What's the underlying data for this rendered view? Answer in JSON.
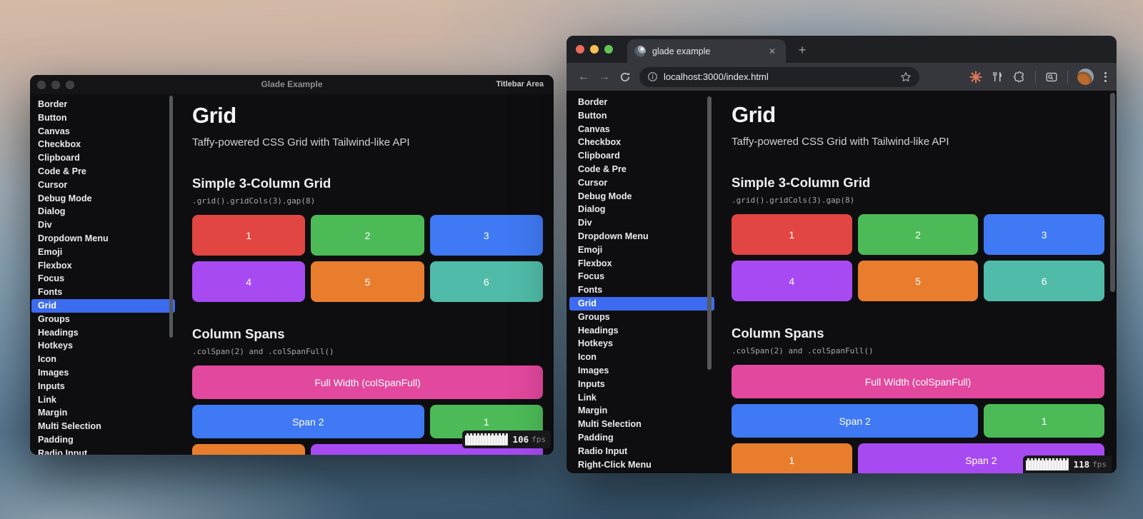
{
  "app_window": {
    "title": "Glade Example",
    "titlebar_right": "Titlebar Area",
    "fps": {
      "value": "106",
      "unit": "fps"
    },
    "traffic_light_inactive_color": "#3e3f43"
  },
  "browser_window": {
    "tab_title": "glade example",
    "url": "localhost:3000/index.html",
    "fps": {
      "value": "118",
      "unit": "fps"
    },
    "traffic_light_colors": [
      "#ed6a5e",
      "#f4bf50",
      "#61c454"
    ],
    "icons": {
      "back": "←",
      "forward": "→",
      "new_tab": "+",
      "close_tab": "✕",
      "menu": "⋮",
      "named": [
        "globe-favicon",
        "reload-icon",
        "site-info-icon",
        "bookmark-star-icon",
        "starburst-extension-icon",
        "utensils-extension-icon",
        "extensions-puzzle-icon",
        "side-panel-search-icon",
        "profile-avatar",
        "menu-dots-icon"
      ]
    }
  },
  "sidebar": {
    "selected_color": "#3c6bf0",
    "items": [
      {
        "label": "Border",
        "selected": false
      },
      {
        "label": "Button",
        "selected": false
      },
      {
        "label": "Canvas",
        "selected": false
      },
      {
        "label": "Checkbox",
        "selected": false
      },
      {
        "label": "Clipboard",
        "selected": false
      },
      {
        "label": "Code & Pre",
        "selected": false
      },
      {
        "label": "Cursor",
        "selected": false
      },
      {
        "label": "Debug Mode",
        "selected": false
      },
      {
        "label": "Dialog",
        "selected": false
      },
      {
        "label": "Div",
        "selected": false
      },
      {
        "label": "Dropdown Menu",
        "selected": false
      },
      {
        "label": "Emoji",
        "selected": false
      },
      {
        "label": "Flexbox",
        "selected": false
      },
      {
        "label": "Focus",
        "selected": false
      },
      {
        "label": "Fonts",
        "selected": false
      },
      {
        "label": "Grid",
        "selected": true
      },
      {
        "label": "Groups",
        "selected": false
      },
      {
        "label": "Headings",
        "selected": false
      },
      {
        "label": "Hotkeys",
        "selected": false
      },
      {
        "label": "Icon",
        "selected": false
      },
      {
        "label": "Images",
        "selected": false
      },
      {
        "label": "Inputs",
        "selected": false
      },
      {
        "label": "Link",
        "selected": false
      },
      {
        "label": "Margin",
        "selected": false
      },
      {
        "label": "Multi Selection",
        "selected": false
      },
      {
        "label": "Padding",
        "selected": false
      },
      {
        "label": "Radio Input",
        "selected": false
      },
      {
        "label": "Right-Click Menu",
        "selected": false
      }
    ]
  },
  "page": {
    "title": "Grid",
    "subtitle": "Taffy-powered CSS Grid with Tailwind-like API",
    "simple_grid": {
      "heading": "Simple 3-Column Grid",
      "code": ".grid().gridCols(3).gap(8)",
      "cells": [
        {
          "label": "1",
          "color": "#e14643",
          "span": 1
        },
        {
          "label": "2",
          "color": "#4cbb57",
          "span": 1
        },
        {
          "label": "3",
          "color": "#3f79f3",
          "span": 1
        },
        {
          "label": "4",
          "color": "#a74af2",
          "span": 1
        },
        {
          "label": "5",
          "color": "#e97d2e",
          "span": 1
        },
        {
          "label": "6",
          "color": "#50bba8",
          "span": 1
        }
      ]
    },
    "column_spans": {
      "heading": "Column Spans",
      "code": ".colSpan(2) and .colSpanFull()",
      "cells": [
        {
          "label": "Full Width (colSpanFull)",
          "color": "#e2489d",
          "span": 3
        },
        {
          "label": "Span 2",
          "color": "#3f79f3",
          "span": 2
        },
        {
          "label": "1",
          "color": "#4cbb57",
          "span": 1
        },
        {
          "label": "1",
          "color": "#e97d2e",
          "span": 1
        },
        {
          "label": "Span 2",
          "color": "#a74af2",
          "span": 2
        }
      ]
    }
  }
}
